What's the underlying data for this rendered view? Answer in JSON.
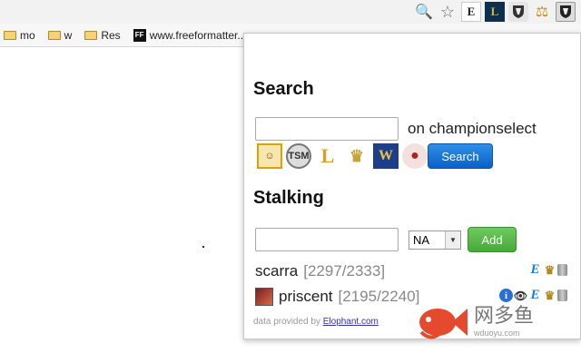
{
  "browser": {
    "bookmarks": [
      {
        "label": "mo",
        "type": "folder"
      },
      {
        "label": "w",
        "type": "folder"
      },
      {
        "label": "Res",
        "type": "folder"
      },
      {
        "label": "www.freeformatter...",
        "type": "site"
      }
    ],
    "ext_icons": [
      "zoom-icon",
      "star-icon",
      "e-ext-icon",
      "lol-ext-icon",
      "shield-ext-icon",
      "scale-ext-icon",
      "shield-active-icon"
    ]
  },
  "popup": {
    "search_heading": "Search",
    "search_input_value": "",
    "on_label": "on championselect",
    "champ_icons": [
      "champion-icon",
      "tsm-icon",
      "lol-icon",
      "crown-icon",
      "warcraft-icon",
      "bird-icon"
    ],
    "search_button": "Search",
    "stalking_heading": "Stalking",
    "stalk_input_value": "",
    "region_value": "NA",
    "add_button": "Add",
    "players": [
      {
        "name": "scarra",
        "rating": "[2297/2333]",
        "avatar": false,
        "icons": [
          "e",
          "crown",
          "trash"
        ]
      },
      {
        "name": "priscent",
        "rating": "[2195/2240]",
        "avatar": true,
        "icons": [
          "info",
          "eye",
          "e",
          "crown",
          "trash"
        ]
      }
    ],
    "footer_text": "data provided by",
    "footer_link": "Elophant.com"
  },
  "watermark": {
    "cn": "网多鱼",
    "url": "wduoyu.com"
  },
  "colors": {
    "search_button": "#1a73d9",
    "add_button": "#5cb94c",
    "rating": "#888888"
  }
}
